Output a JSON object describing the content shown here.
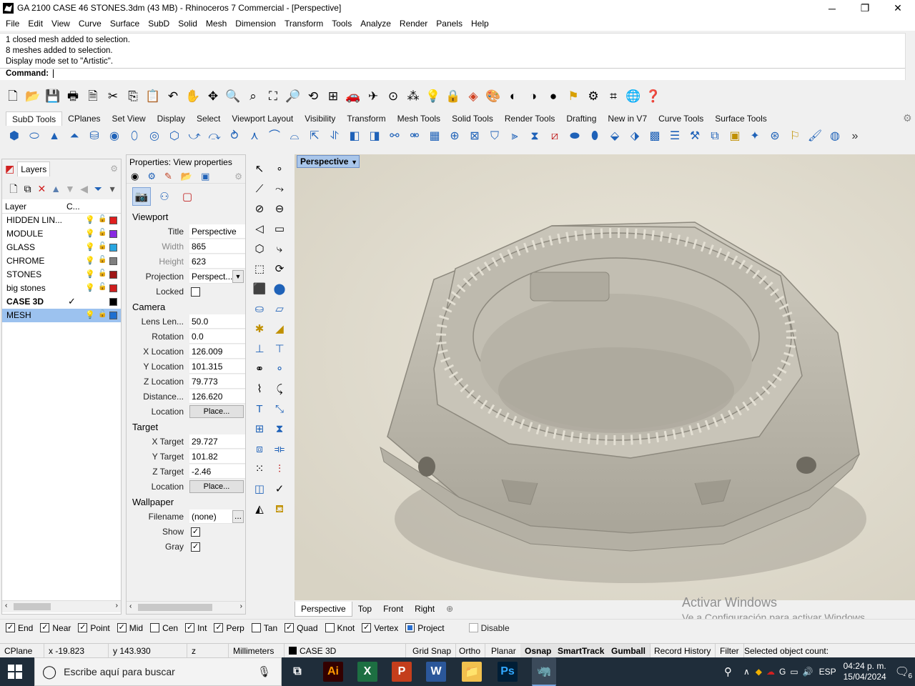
{
  "window": {
    "title": "GA 2100 CASE 46 STONES.3dm (43 MB) - Rhinoceros 7 Commercial - [Perspective]",
    "minimize": "─",
    "maximize": "❐",
    "close": "✕"
  },
  "menu": [
    "File",
    "Edit",
    "View",
    "Curve",
    "Surface",
    "SubD",
    "Solid",
    "Mesh",
    "Dimension",
    "Transform",
    "Tools",
    "Analyze",
    "Render",
    "Panels",
    "Help"
  ],
  "command": {
    "history": [
      "1 closed mesh added to selection.",
      "8 meshes added to selection.",
      "Display mode set to \"Artistic\"."
    ],
    "prompt": "Command:"
  },
  "toolbar_tabs": [
    "SubD Tools",
    "CPlanes",
    "Set View",
    "Display",
    "Select",
    "Viewport Layout",
    "Visibility",
    "Transform",
    "Mesh Tools",
    "Solid Tools",
    "Render Tools",
    "Drafting",
    "New in V7",
    "Curve Tools",
    "Surface Tools"
  ],
  "layers": {
    "title": "Layers",
    "col_layer": "Layer",
    "col_c": "C...",
    "items": [
      {
        "name": "HIDDEN LIN...",
        "color": "#e02020",
        "bulb": "on",
        "check": ""
      },
      {
        "name": "MODULE",
        "color": "#8a2be2",
        "bulb": "on",
        "check": ""
      },
      {
        "name": "GLASS",
        "color": "#2aa6e0",
        "bulb": "on",
        "check": ""
      },
      {
        "name": "CHROME",
        "color": "#808080",
        "bulb": "on",
        "check": ""
      },
      {
        "name": "STONES",
        "color": "#a01818",
        "bulb": "off",
        "check": ""
      },
      {
        "name": "big stones",
        "color": "#d02020",
        "bulb": "off",
        "check": ""
      },
      {
        "name": "CASE 3D",
        "color": "#000000",
        "bulb": "",
        "check": "✓"
      },
      {
        "name": "MESH",
        "color": "#1e6fd0",
        "bulb": "on",
        "check": ""
      }
    ]
  },
  "properties": {
    "title": "Properties: View properties",
    "viewport": {
      "section": "Viewport",
      "title_label": "Title",
      "title_value": "Perspective",
      "width_label": "Width",
      "width_value": "865",
      "height_label": "Height",
      "height_value": "623",
      "projection_label": "Projection",
      "projection_value": "Perspect...",
      "locked_label": "Locked"
    },
    "camera": {
      "section": "Camera",
      "lens_label": "Lens Len...",
      "lens_value": "50.0",
      "rotation_label": "Rotation",
      "rotation_value": "0.0",
      "x_label": "X Location",
      "x_value": "126.009",
      "y_label": "Y Location",
      "y_value": "101.315",
      "z_label": "Z Location",
      "z_value": "79.773",
      "dist_label": "Distance...",
      "dist_value": "126.620",
      "loc_label": "Location",
      "loc_button": "Place..."
    },
    "target": {
      "section": "Target",
      "x_label": "X Target",
      "x_value": "29.727",
      "y_label": "Y Target",
      "y_value": "101.82",
      "z_label": "Z Target",
      "z_value": "-2.46",
      "loc_label": "Location",
      "loc_button": "Place..."
    },
    "wallpaper": {
      "section": "Wallpaper",
      "file_label": "Filename",
      "file_value": "(none)",
      "file_button": "...",
      "show_label": "Show",
      "gray_label": "Gray"
    }
  },
  "viewport": {
    "active_label": "Perspective",
    "tabs": [
      "Perspective",
      "Top",
      "Front",
      "Right"
    ],
    "add_tab": "⊕"
  },
  "watermark": {
    "line1": "Activar Windows",
    "line2": "Ve a Configuración para activar Windows."
  },
  "osnap": [
    {
      "label": "End",
      "checked": true
    },
    {
      "label": "Near",
      "checked": true
    },
    {
      "label": "Point",
      "checked": true
    },
    {
      "label": "Mid",
      "checked": true
    },
    {
      "label": "Cen",
      "checked": false
    },
    {
      "label": "Int",
      "checked": true
    },
    {
      "label": "Perp",
      "checked": true
    },
    {
      "label": "Tan",
      "checked": false
    },
    {
      "label": "Quad",
      "checked": true
    },
    {
      "label": "Knot",
      "checked": false
    },
    {
      "label": "Vertex",
      "checked": true
    },
    {
      "label": "Project",
      "checked": true
    },
    {
      "label": "Disable",
      "checked": false
    }
  ],
  "status": {
    "cplane": "CPlane",
    "x": "x -19.823",
    "y": "y 143.930",
    "z": "z",
    "units": "Millimeters",
    "layer": "CASE 3D",
    "grid_snap": "Grid Snap",
    "ortho": "Ortho",
    "planar": "Planar",
    "osnap": "Osnap",
    "smarttrack": "SmartTrack",
    "gumball": "Gumball",
    "record_history": "Record History",
    "filter": "Filter",
    "selected": "Selected object count:"
  },
  "taskbar": {
    "search_placeholder": "Escribe aquí para buscar",
    "time": "04:24 p. m.",
    "date": "15/04/2024",
    "lang": "ESP",
    "notif_count": "6",
    "apps": [
      {
        "name": "illustrator",
        "label": "Ai",
        "bg": "#330000",
        "fg": "#ff9a00"
      },
      {
        "name": "excel",
        "label": "X",
        "bg": "#1d6f42",
        "fg": "#ffffff"
      },
      {
        "name": "powerpoint",
        "label": "P",
        "bg": "#c43e1c",
        "fg": "#ffffff"
      },
      {
        "name": "word",
        "label": "W",
        "bg": "#2b579a",
        "fg": "#ffffff"
      },
      {
        "name": "explorer",
        "label": "📁",
        "bg": "#f2c14e",
        "fg": "#7a5200"
      },
      {
        "name": "photoshop",
        "label": "Ps",
        "bg": "#001e36",
        "fg": "#31a8ff"
      },
      {
        "name": "rhino",
        "label": "🦏",
        "bg": "#3b4a5a",
        "fg": "#ffffff"
      }
    ]
  }
}
